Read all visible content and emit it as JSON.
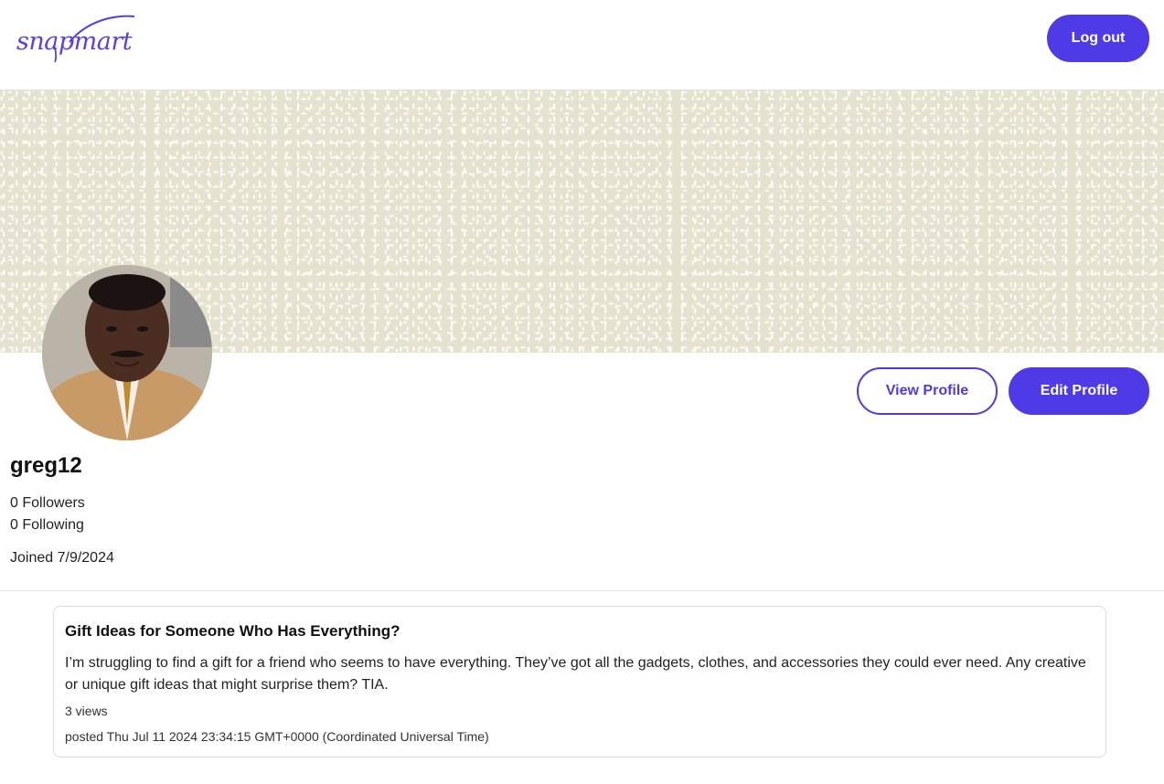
{
  "header": {
    "logo_text": "snapmart",
    "logout_label": "Log out"
  },
  "colors": {
    "accent": "#4f3be5",
    "banner": "#e5e2cf"
  },
  "profile": {
    "username": "greg12",
    "followers": "0 Followers",
    "following": "0 Following",
    "joined": "Joined 7/9/2024",
    "view_profile_label": "View Profile",
    "edit_profile_label": "Edit Profile"
  },
  "posts": [
    {
      "title": "Gift Ideas for Someone Who Has Everything?",
      "body": "I’m struggling to find a gift for a friend who seems to have everything. They’ve got all the gadgets, clothes, and accessories they could ever need. Any creative or unique gift ideas that might surprise them? TIA.",
      "views": "3 views",
      "posted": "posted Thu Jul 11 2024 23:34:15 GMT+0000 (Coordinated Universal Time)"
    }
  ]
}
